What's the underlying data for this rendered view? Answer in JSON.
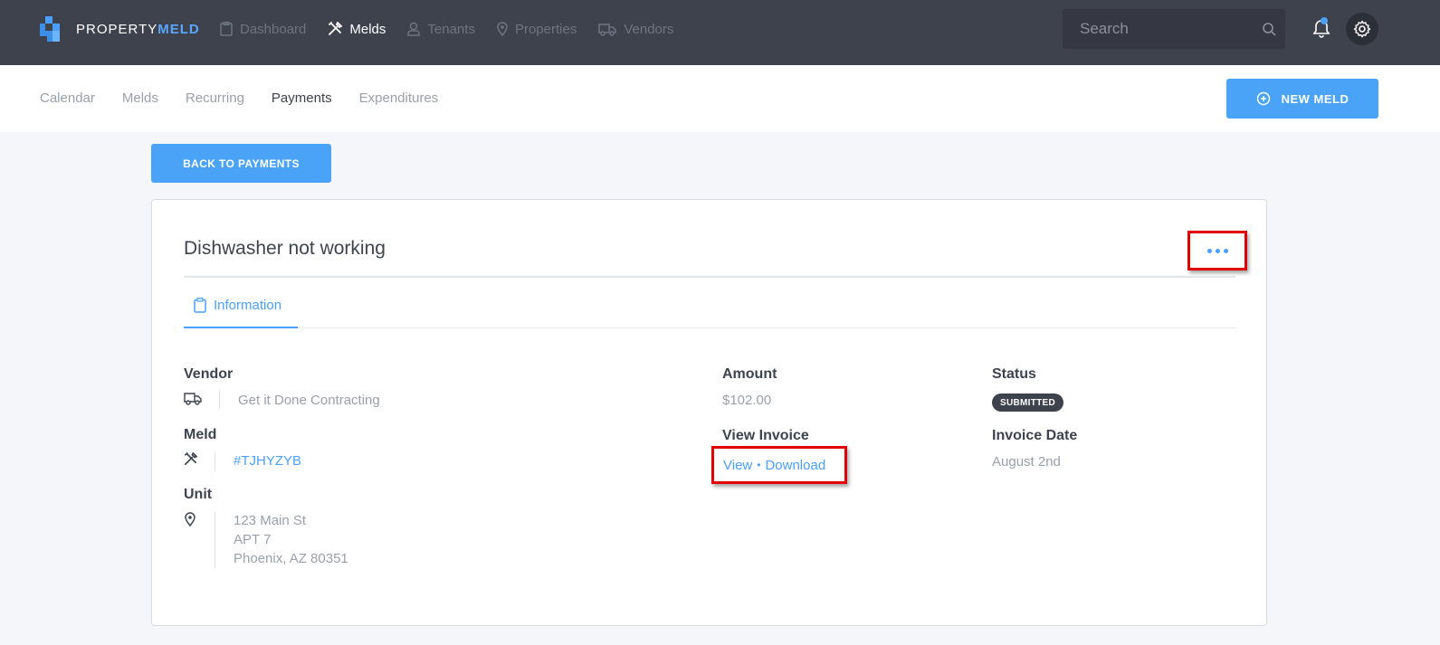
{
  "brand": {
    "name_part1": "PROPERTY",
    "name_part2": "MELD"
  },
  "nav": [
    {
      "label": "Dashboard",
      "icon": "clipboard-icon"
    },
    {
      "label": "Melds",
      "icon": "tools-icon",
      "active": true
    },
    {
      "label": "Tenants",
      "icon": "user-icon"
    },
    {
      "label": "Properties",
      "icon": "map-pin-icon"
    },
    {
      "label": "Vendors",
      "icon": "truck-icon"
    }
  ],
  "search": {
    "placeholder": "Search"
  },
  "subnav": {
    "tabs": [
      "Calendar",
      "Melds",
      "Recurring",
      "Payments",
      "Expenditures"
    ],
    "active_tab": "Payments",
    "new_meld_label": "NEW MELD"
  },
  "back_button_label": "BACK TO PAYMENTS",
  "card": {
    "title": "Dishwasher not working",
    "tab_label": "Information",
    "vendor": {
      "label": "Vendor",
      "value": "Get it Done Contracting"
    },
    "meld": {
      "label": "Meld",
      "value": "#TJHYZYB"
    },
    "unit": {
      "label": "Unit",
      "line1": "123 Main St",
      "line2": "APT 7",
      "line3": "Phoenix, AZ 80351"
    },
    "amount": {
      "label": "Amount",
      "value": "$102.00"
    },
    "invoice": {
      "label": "View Invoice",
      "view": "View",
      "separator": "•",
      "download": "Download"
    },
    "status": {
      "label": "Status",
      "value": "SUBMITTED"
    },
    "invoice_date": {
      "label": "Invoice Date",
      "value": "August 2nd"
    }
  },
  "colors": {
    "accent": "#4aa3f7",
    "topbar": "#3e424d",
    "highlight": "#e00000"
  }
}
